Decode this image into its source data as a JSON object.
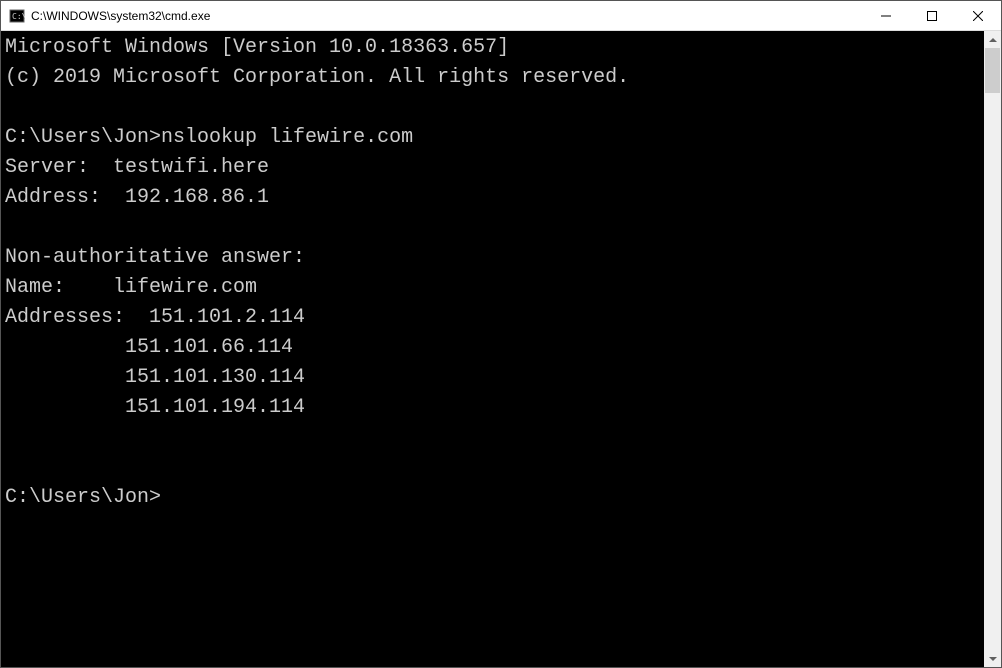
{
  "window": {
    "title": "C:\\WINDOWS\\system32\\cmd.exe"
  },
  "terminal": {
    "banner_line1": "Microsoft Windows [Version 10.0.18363.657]",
    "banner_line2": "(c) 2019 Microsoft Corporation. All rights reserved.",
    "prompt1_path": "C:\\Users\\Jon>",
    "prompt1_command": "nslookup lifewire.com",
    "server_label": "Server:  ",
    "server_value": "testwifi.here",
    "address_label": "Address:  ",
    "address_value": "192.168.86.1",
    "nonauth_label": "Non-authoritative answer:",
    "name_label": "Name:    ",
    "name_value": "lifewire.com",
    "addresses_label": "Addresses:  ",
    "addresses": [
      "151.101.2.114",
      "151.101.66.114",
      "151.101.130.114",
      "151.101.194.114"
    ],
    "addresses_indent": "          ",
    "prompt2_path": "C:\\Users\\Jon>"
  }
}
